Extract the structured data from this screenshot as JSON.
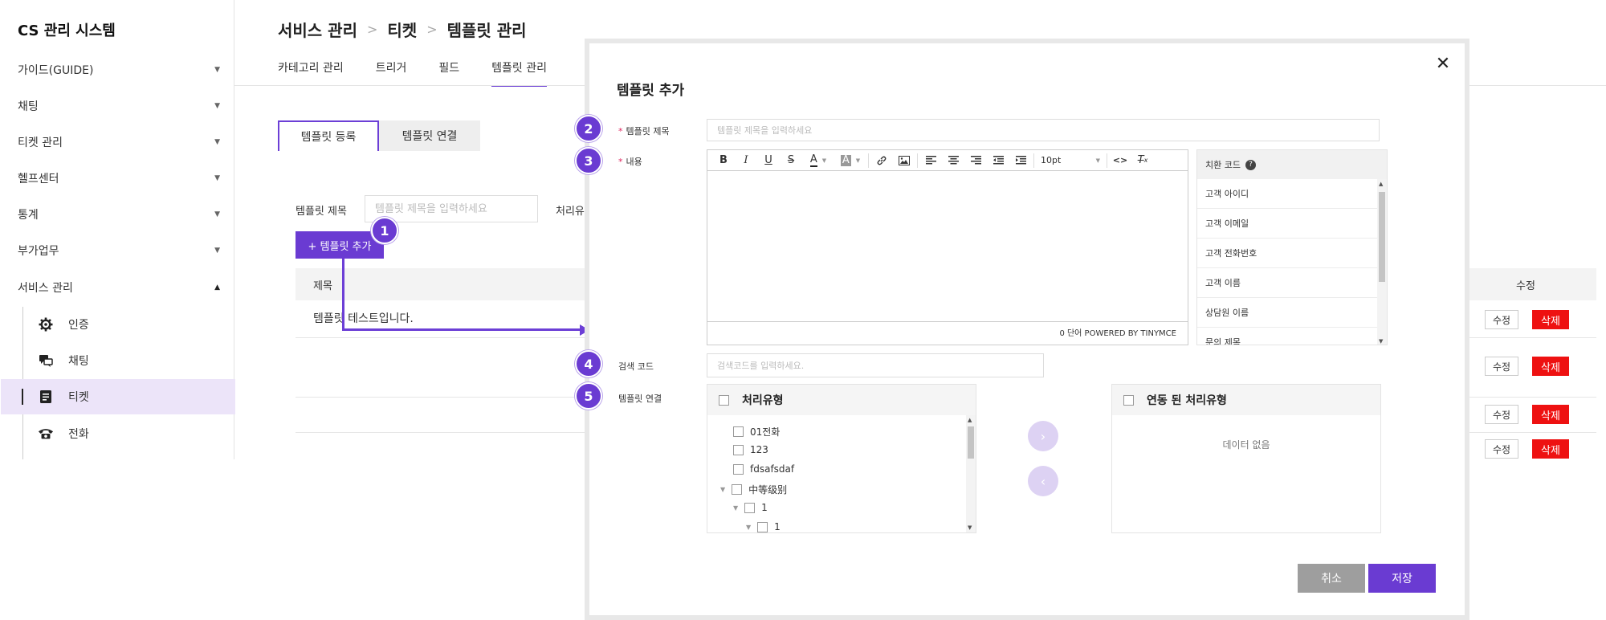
{
  "sidebar": {
    "title": "CS 관리 시스템",
    "menu": [
      {
        "label": "가이드(GUIDE)"
      },
      {
        "label": "채팅"
      },
      {
        "label": "티켓 관리"
      },
      {
        "label": "헬프센터"
      },
      {
        "label": "통계"
      },
      {
        "label": "부가업무"
      },
      {
        "label": "서비스 관리"
      }
    ],
    "submenu": [
      {
        "label": "인증",
        "icon": "gear-icon"
      },
      {
        "label": "채팅",
        "icon": "chat-icon"
      },
      {
        "label": "티켓",
        "icon": "ticket-icon"
      },
      {
        "label": "전화",
        "icon": "phone-icon"
      }
    ]
  },
  "header": {
    "breadcrumb": [
      "서비스 관리",
      "티켓",
      "템플릿 관리"
    ],
    "tabs": [
      "카테고리 관리",
      "트리거",
      "필드",
      "템플릿 관리"
    ],
    "active_tab": "템플릿 관리"
  },
  "content": {
    "sub_tabs": [
      "템플릿 등록",
      "템플릿 연결"
    ],
    "filter_label": "템플릿 제목",
    "filter_placeholder": "템플릿 제목을 입력하세요",
    "filter_label2": "처리유",
    "add_button": "+ 템플릿 추가",
    "table": {
      "col_title": "제목",
      "col_edit": "수정",
      "row1_title": "템플릿 테스트입니다.",
      "edit_label": "수정",
      "delete_label": "삭제"
    }
  },
  "badges": [
    "1",
    "2",
    "3",
    "4",
    "5"
  ],
  "modal": {
    "title": "템플릿 추가",
    "close": "✕",
    "title_label": "템플릿 제목",
    "title_placeholder": "템플릿 제목을 입력하세요",
    "content_label": "내용",
    "font_size": "10pt",
    "editor_status": "0 단어 POWERED BY TINYMCE",
    "code_panel": {
      "header": "치환 코드",
      "items": [
        "고객 아이디",
        "고객 이메일",
        "고객 전화번호",
        "고객 이름",
        "상담원 이름",
        "문의 제목"
      ]
    },
    "search_label": "검색 코드",
    "search_placeholder": "검색코드를 입력하세요.",
    "link_label": "템플릿 연결",
    "left_list": {
      "header": "처리유형",
      "items": [
        "01전화",
        "123",
        "fdsafsdaf",
        "中等级别",
        "1",
        "1"
      ]
    },
    "right_list": {
      "header": "연동 된 처리유형",
      "empty": "데이터 없음"
    },
    "cancel": "취소",
    "save": "저장"
  },
  "colors": {
    "accent": "#6a3bd2",
    "danger": "#ee1111",
    "sidebar_active": "#ece4f9"
  }
}
